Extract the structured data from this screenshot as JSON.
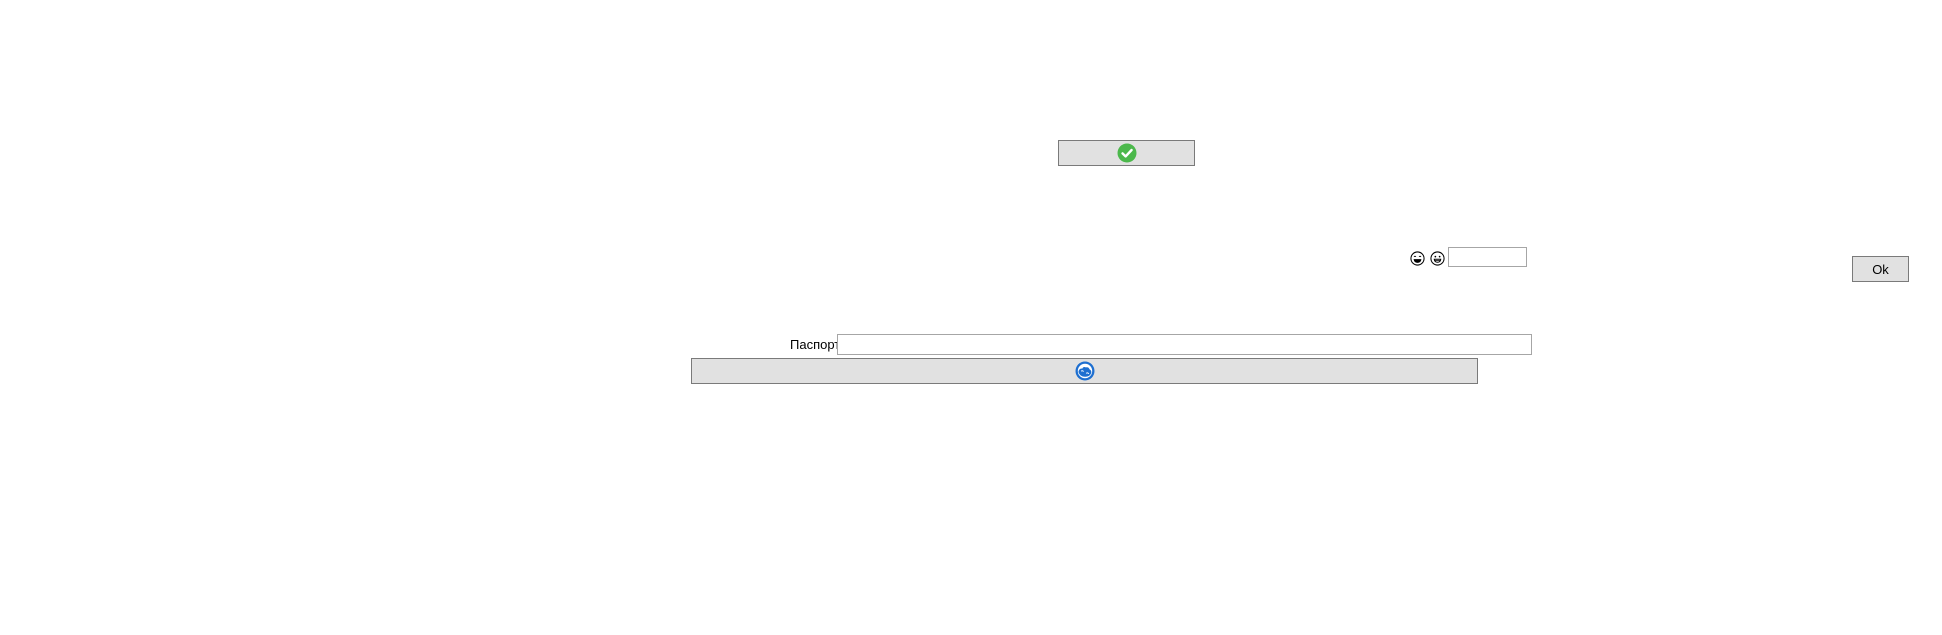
{
  "ok_button": {
    "label": "Ok"
  },
  "passport": {
    "label": "Паспорт",
    "value": ""
  },
  "small_input": {
    "value": ""
  },
  "icons": {
    "confirm": "check-circle-icon",
    "emoji_one": "laughing-face-icon",
    "emoji_two": "grinning-face-icon",
    "wide": "blue-globe-icon"
  },
  "colors": {
    "check_green": "#4cb84c",
    "globe_blue": "#1e6fd0",
    "button_face": "#e1e1e1",
    "button_border": "#7a7a7a"
  }
}
